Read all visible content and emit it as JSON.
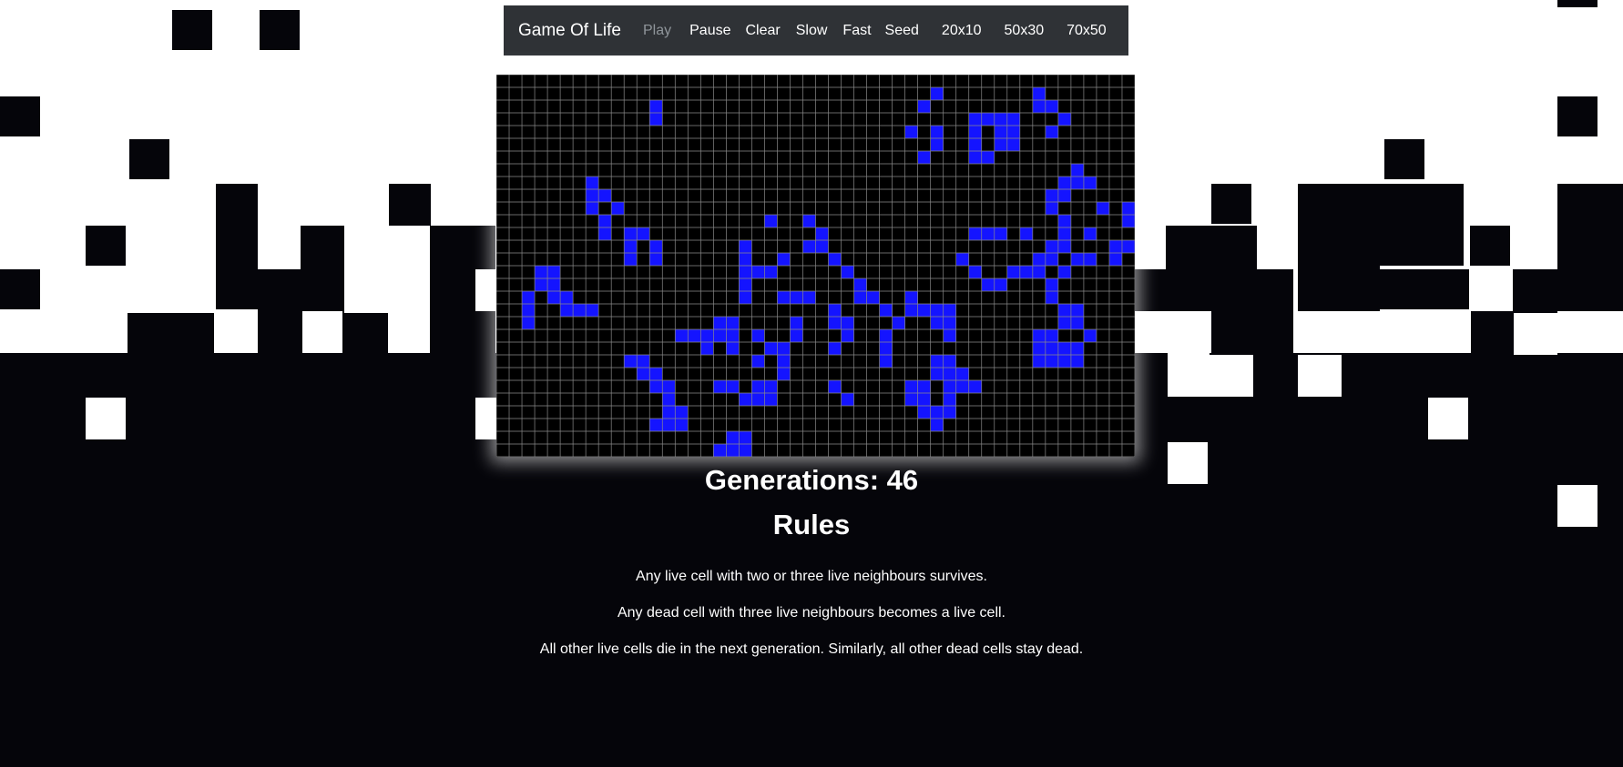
{
  "navbar": {
    "brand": "Game Of Life",
    "items": [
      {
        "label": "Play",
        "state": "disabled"
      },
      {
        "label": "Pause"
      },
      {
        "label": "Clear"
      },
      {
        "label": "Slow"
      },
      {
        "label": "Fast"
      },
      {
        "label": "Seed"
      },
      {
        "label": "20x10"
      },
      {
        "label": "50x30"
      },
      {
        "label": "70x50"
      }
    ]
  },
  "colors": {
    "live_cell": "#1414ff",
    "dead_cell": "#000000",
    "grid_line": "#8a8a8a",
    "page_dark": "#05050a",
    "navbar": "#2f3236"
  },
  "board": {
    "cols": 50,
    "rows": 30,
    "live_cells": [
      [
        1,
        34
      ],
      [
        1,
        42
      ],
      [
        2,
        12
      ],
      [
        2,
        33
      ],
      [
        2,
        42
      ],
      [
        2,
        43
      ],
      [
        3,
        12
      ],
      [
        3,
        37
      ],
      [
        3,
        38
      ],
      [
        3,
        39
      ],
      [
        3,
        40
      ],
      [
        3,
        44
      ],
      [
        4,
        32
      ],
      [
        4,
        34
      ],
      [
        4,
        37
      ],
      [
        4,
        39
      ],
      [
        4,
        40
      ],
      [
        4,
        43
      ],
      [
        5,
        34
      ],
      [
        5,
        37
      ],
      [
        5,
        39
      ],
      [
        5,
        40
      ],
      [
        6,
        33
      ],
      [
        6,
        37
      ],
      [
        6,
        38
      ],
      [
        7,
        45
      ],
      [
        8,
        7
      ],
      [
        8,
        44
      ],
      [
        8,
        45
      ],
      [
        8,
        46
      ],
      [
        9,
        7
      ],
      [
        9,
        8
      ],
      [
        9,
        43
      ],
      [
        9,
        44
      ],
      [
        10,
        7
      ],
      [
        10,
        9
      ],
      [
        10,
        43
      ],
      [
        10,
        47
      ],
      [
        10,
        49
      ],
      [
        11,
        8
      ],
      [
        11,
        21
      ],
      [
        11,
        24
      ],
      [
        11,
        44
      ],
      [
        11,
        49
      ],
      [
        12,
        8
      ],
      [
        12,
        10
      ],
      [
        12,
        11
      ],
      [
        12,
        25
      ],
      [
        12,
        37
      ],
      [
        12,
        38
      ],
      [
        12,
        39
      ],
      [
        12,
        41
      ],
      [
        12,
        44
      ],
      [
        12,
        46
      ],
      [
        13,
        10
      ],
      [
        13,
        12
      ],
      [
        13,
        19
      ],
      [
        13,
        24
      ],
      [
        13,
        25
      ],
      [
        13,
        43
      ],
      [
        13,
        44
      ],
      [
        13,
        48
      ],
      [
        13,
        49
      ],
      [
        14,
        10
      ],
      [
        14,
        12
      ],
      [
        14,
        19
      ],
      [
        14,
        22
      ],
      [
        14,
        26
      ],
      [
        14,
        36
      ],
      [
        14,
        42
      ],
      [
        14,
        43
      ],
      [
        14,
        45
      ],
      [
        14,
        46
      ],
      [
        14,
        48
      ],
      [
        15,
        3
      ],
      [
        15,
        4
      ],
      [
        15,
        19
      ],
      [
        15,
        20
      ],
      [
        15,
        21
      ],
      [
        15,
        27
      ],
      [
        15,
        37
      ],
      [
        15,
        40
      ],
      [
        15,
        41
      ],
      [
        15,
        42
      ],
      [
        15,
        44
      ],
      [
        16,
        3
      ],
      [
        16,
        4
      ],
      [
        16,
        19
      ],
      [
        16,
        28
      ],
      [
        16,
        38
      ],
      [
        16,
        39
      ],
      [
        16,
        43
      ],
      [
        17,
        2
      ],
      [
        17,
        4
      ],
      [
        17,
        5
      ],
      [
        17,
        19
      ],
      [
        17,
        22
      ],
      [
        17,
        23
      ],
      [
        17,
        24
      ],
      [
        17,
        28
      ],
      [
        17,
        29
      ],
      [
        17,
        32
      ],
      [
        17,
        43
      ],
      [
        18,
        2
      ],
      [
        18,
        5
      ],
      [
        18,
        6
      ],
      [
        18,
        7
      ],
      [
        18,
        26
      ],
      [
        18,
        30
      ],
      [
        18,
        32
      ],
      [
        18,
        33
      ],
      [
        18,
        34
      ],
      [
        18,
        35
      ],
      [
        18,
        44
      ],
      [
        18,
        45
      ],
      [
        19,
        2
      ],
      [
        19,
        17
      ],
      [
        19,
        18
      ],
      [
        19,
        23
      ],
      [
        19,
        26
      ],
      [
        19,
        27
      ],
      [
        19,
        31
      ],
      [
        19,
        34
      ],
      [
        19,
        35
      ],
      [
        19,
        44
      ],
      [
        19,
        45
      ],
      [
        20,
        14
      ],
      [
        20,
        15
      ],
      [
        20,
        16
      ],
      [
        20,
        17
      ],
      [
        20,
        18
      ],
      [
        20,
        20
      ],
      [
        20,
        23
      ],
      [
        20,
        27
      ],
      [
        20,
        30
      ],
      [
        20,
        35
      ],
      [
        20,
        42
      ],
      [
        20,
        43
      ],
      [
        20,
        46
      ],
      [
        21,
        16
      ],
      [
        21,
        18
      ],
      [
        21,
        21
      ],
      [
        21,
        22
      ],
      [
        21,
        26
      ],
      [
        21,
        30
      ],
      [
        21,
        42
      ],
      [
        21,
        43
      ],
      [
        21,
        44
      ],
      [
        21,
        45
      ],
      [
        22,
        10
      ],
      [
        22,
        11
      ],
      [
        22,
        20
      ],
      [
        22,
        22
      ],
      [
        22,
        30
      ],
      [
        22,
        34
      ],
      [
        22,
        35
      ],
      [
        22,
        42
      ],
      [
        22,
        43
      ],
      [
        22,
        44
      ],
      [
        22,
        45
      ],
      [
        23,
        11
      ],
      [
        23,
        12
      ],
      [
        23,
        22
      ],
      [
        23,
        34
      ],
      [
        23,
        35
      ],
      [
        23,
        36
      ],
      [
        24,
        12
      ],
      [
        24,
        13
      ],
      [
        24,
        17
      ],
      [
        24,
        18
      ],
      [
        24,
        20
      ],
      [
        24,
        21
      ],
      [
        24,
        26
      ],
      [
        24,
        32
      ],
      [
        24,
        33
      ],
      [
        24,
        35
      ],
      [
        24,
        36
      ],
      [
        24,
        37
      ],
      [
        25,
        13
      ],
      [
        25,
        19
      ],
      [
        25,
        20
      ],
      [
        25,
        21
      ],
      [
        25,
        27
      ],
      [
        25,
        32
      ],
      [
        25,
        33
      ],
      [
        25,
        35
      ],
      [
        26,
        13
      ],
      [
        26,
        14
      ],
      [
        26,
        33
      ],
      [
        26,
        34
      ],
      [
        26,
        35
      ],
      [
        27,
        12
      ],
      [
        27,
        13
      ],
      [
        27,
        14
      ],
      [
        27,
        34
      ],
      [
        28,
        18
      ],
      [
        28,
        19
      ],
      [
        29,
        17
      ],
      [
        29,
        18
      ],
      [
        29,
        19
      ]
    ]
  },
  "generations_text": "Generations: 46",
  "rules": {
    "title": "Rules",
    "lines": [
      "Any live cell with two or three live neighbours survives.",
      "Any dead cell with three live neighbours becomes a live cell.",
      "All other live cells die in the next generation. Similarly, all other dead cells stay dead."
    ]
  }
}
